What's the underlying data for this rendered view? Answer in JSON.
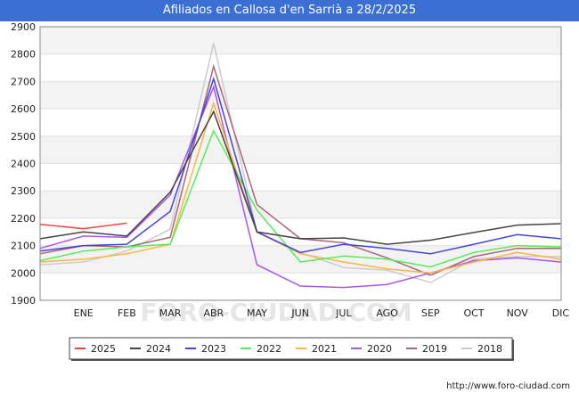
{
  "page": {
    "title": "Afiliados en Callosa d'en Sarrià a 28/2/2025",
    "footer_url": "http://www.foro-ciudad.com",
    "watermark": "FORO-CIUDAD.COM"
  },
  "chart_data": {
    "type": "line",
    "title": "Afiliados en Callosa d'en Sarrià a 28/2/2025",
    "xlabel": "",
    "ylabel": "",
    "categories": [
      "",
      "ENE",
      "FEB",
      "MAR",
      "ABR",
      "MAY",
      "JUN",
      "JUL",
      "AGO",
      "SEP",
      "OCT",
      "NOV",
      "DIC"
    ],
    "ylim": [
      1900,
      2900
    ],
    "yticks": [
      1900,
      2000,
      2100,
      2200,
      2300,
      2400,
      2500,
      2600,
      2700,
      2800,
      2900
    ],
    "grid": true,
    "legend_position": "bottom",
    "series": [
      {
        "name": "2025",
        "color": "#ee4444",
        "values": [
          2178,
          2162,
          2182
        ]
      },
      {
        "name": "2024",
        "color": "#444444",
        "values": [
          2125,
          2150,
          2135,
          2295,
          2590,
          2150,
          2125,
          2128,
          2105,
          2120,
          2148,
          2175,
          2180
        ]
      },
      {
        "name": "2023",
        "color": "#4444dd",
        "values": [
          2080,
          2100,
          2105,
          2225,
          2710,
          2150,
          2075,
          2105,
          2090,
          2070,
          2105,
          2140,
          2125
        ]
      },
      {
        "name": "2022",
        "color": "#55ee55",
        "values": [
          2045,
          2080,
          2095,
          2105,
          2520,
          2230,
          2040,
          2062,
          2050,
          2022,
          2075,
          2100,
          2095
        ]
      },
      {
        "name": "2021",
        "color": "#ffb344",
        "values": [
          2040,
          2050,
          2070,
          2105,
          2620,
          2150,
          2070,
          2040,
          2015,
          2000,
          2040,
          2075,
          2050
        ]
      },
      {
        "name": "2020",
        "color": "#aa55ee",
        "values": [
          2090,
          2135,
          2130,
          2285,
          2680,
          2030,
          1952,
          1947,
          1958,
          2000,
          2045,
          2055,
          2040
        ]
      },
      {
        "name": "2019",
        "color": "#aa6677",
        "values": [
          2070,
          2100,
          2095,
          2130,
          2755,
          2250,
          2125,
          2110,
          2055,
          1992,
          2060,
          2090,
          2090
        ]
      },
      {
        "name": "2018",
        "color": "#cccccc",
        "values": [
          2030,
          2040,
          2080,
          2160,
          2840,
          2150,
          2075,
          2020,
          2010,
          1965,
          2050,
          2060,
          2060
        ]
      }
    ]
  }
}
